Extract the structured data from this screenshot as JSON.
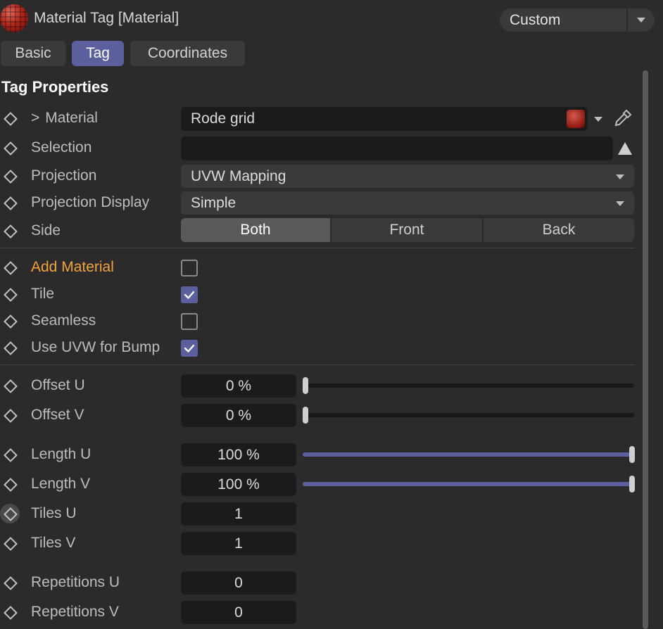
{
  "header": {
    "title": "Material Tag [Material]",
    "thumbnail_icon": "material-sphere-thumbnail",
    "preset_label": "Custom"
  },
  "tabs": [
    {
      "label": "Basic",
      "active": false
    },
    {
      "label": "Tag",
      "active": true
    },
    {
      "label": "Coordinates",
      "active": false
    }
  ],
  "section_title": "Tag Properties",
  "rows": {
    "material": {
      "label": "Material",
      "value": "Rode grid",
      "expand_glyph": ">"
    },
    "selection": {
      "label": "Selection",
      "value": ""
    },
    "projection": {
      "label": "Projection",
      "value": "UVW Mapping"
    },
    "projection_display": {
      "label": "Projection Display",
      "value": "Simple"
    },
    "side": {
      "label": "Side",
      "options": [
        "Both",
        "Front",
        "Back"
      ],
      "selected": "Both"
    },
    "add_material": {
      "label": "Add Material",
      "checked": false,
      "label_color": "#f4a23c"
    },
    "tile": {
      "label": "Tile",
      "checked": true
    },
    "seamless": {
      "label": "Seamless",
      "checked": false
    },
    "use_uvw_for_bump": {
      "label": "Use UVW for Bump",
      "checked": true
    },
    "offset_u": {
      "label": "Offset U",
      "value": "0 %",
      "slider_fraction": 0.0
    },
    "offset_v": {
      "label": "Offset V",
      "value": "0 %",
      "slider_fraction": 0.0
    },
    "length_u": {
      "label": "Length U",
      "value": "100 %",
      "slider_fraction": 1.0
    },
    "length_v": {
      "label": "Length V",
      "value": "100 %",
      "slider_fraction": 1.0
    },
    "tiles_u": {
      "label": "Tiles U",
      "value": "1"
    },
    "tiles_v": {
      "label": "Tiles V",
      "value": "1"
    },
    "repetitions_u": {
      "label": "Repetitions U",
      "value": "0"
    },
    "repetitions_v": {
      "label": "Repetitions V",
      "value": "0"
    }
  },
  "colors": {
    "accent": "#5b5f9e",
    "background": "#2b2b2b",
    "field": "#1b1b1b",
    "highlight_label": "#f4a23c"
  }
}
